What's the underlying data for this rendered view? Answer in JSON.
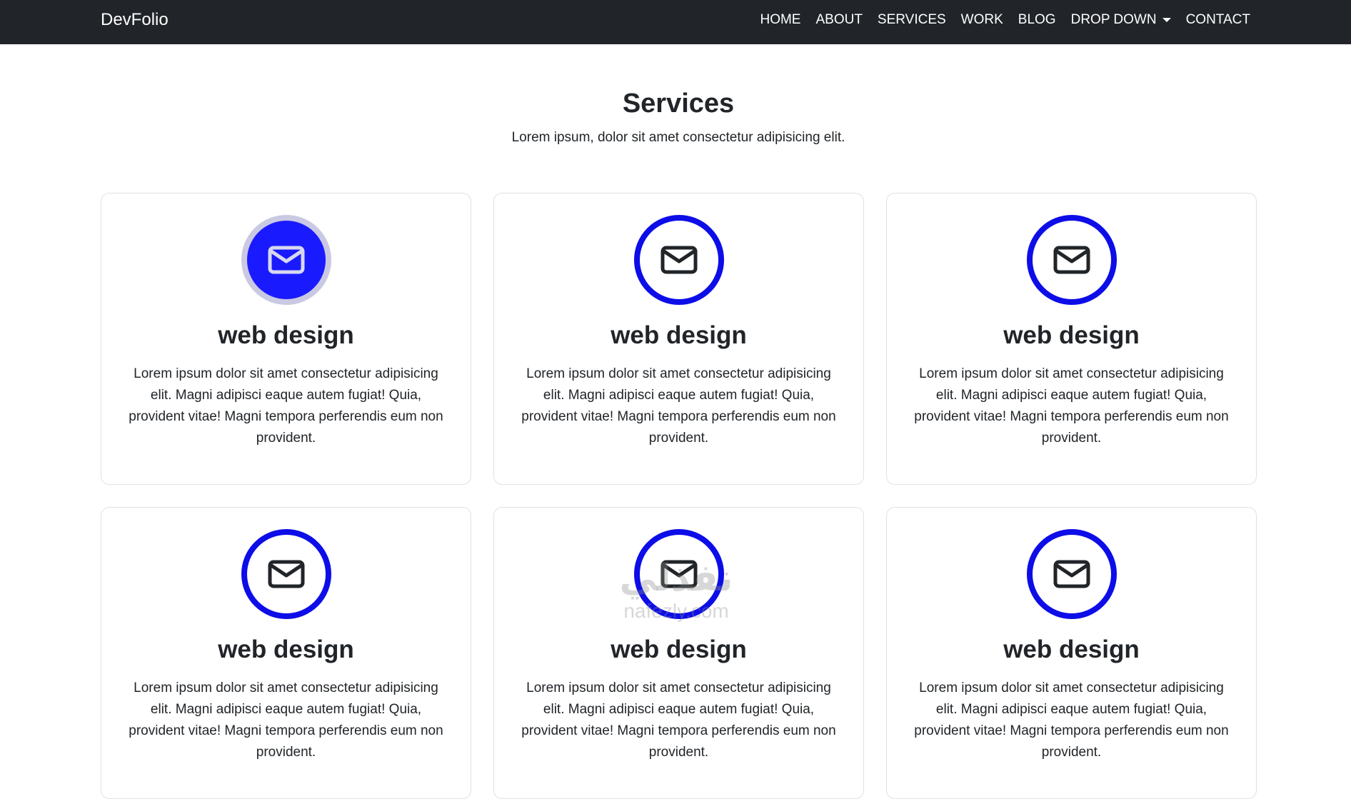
{
  "navbar": {
    "brand": "DevFolio",
    "links": [
      {
        "label": "HOME"
      },
      {
        "label": "ABOUT"
      },
      {
        "label": "SERVICES"
      },
      {
        "label": "WORK"
      },
      {
        "label": "BLOG"
      },
      {
        "label": "DROP DOWN",
        "has_caret": true
      },
      {
        "label": "CONTACT"
      }
    ]
  },
  "section": {
    "title": "Services",
    "subtitle": "Lorem ipsum, dolor sit amet consectetur adipisicing elit."
  },
  "cards": [
    {
      "icon": "envelope-icon",
      "active": true,
      "title": "web design",
      "text": "Lorem ipsum dolor sit amet consectetur adipisicing elit. Magni adipisci eaque autem fugiat! Quia, provident vitae! Magni tempora perferendis eum non provident."
    },
    {
      "icon": "envelope-icon",
      "active": false,
      "title": "web design",
      "text": "Lorem ipsum dolor sit amet consectetur adipisicing elit. Magni adipisci eaque autem fugiat! Quia, provident vitae! Magni tempora perferendis eum non provident."
    },
    {
      "icon": "envelope-icon",
      "active": false,
      "title": "web design",
      "text": "Lorem ipsum dolor sit amet consectetur adipisicing elit. Magni adipisci eaque autem fugiat! Quia, provident vitae! Magni tempora perferendis eum non provident."
    },
    {
      "icon": "envelope-icon",
      "active": false,
      "title": "web design",
      "text": "Lorem ipsum dolor sit amet consectetur adipisicing elit. Magni adipisci eaque autem fugiat! Quia, provident vitae! Magni tempora perferendis eum non provident."
    },
    {
      "icon": "envelope-icon",
      "active": false,
      "title": "web design",
      "text": "Lorem ipsum dolor sit amet consectetur adipisicing elit. Magni adipisci eaque autem fugiat! Quia, provident vitae! Magni tempora perferendis eum non provident."
    },
    {
      "icon": "envelope-icon",
      "active": false,
      "title": "web design",
      "text": "Lorem ipsum dolor sit amet consectetur adipisicing elit. Magni adipisci eaque autem fugiat! Quia, provident vitae! Magni tempora perferendis eum non provident."
    }
  ],
  "watermark": {
    "arabic": "نفذلي",
    "latin": "nafezly.com"
  },
  "colors": {
    "navbar_bg": "#212529",
    "ring_blue": "#0d0de8",
    "active_fill": "#1a1aff",
    "active_ring": "#c9c9e3"
  }
}
